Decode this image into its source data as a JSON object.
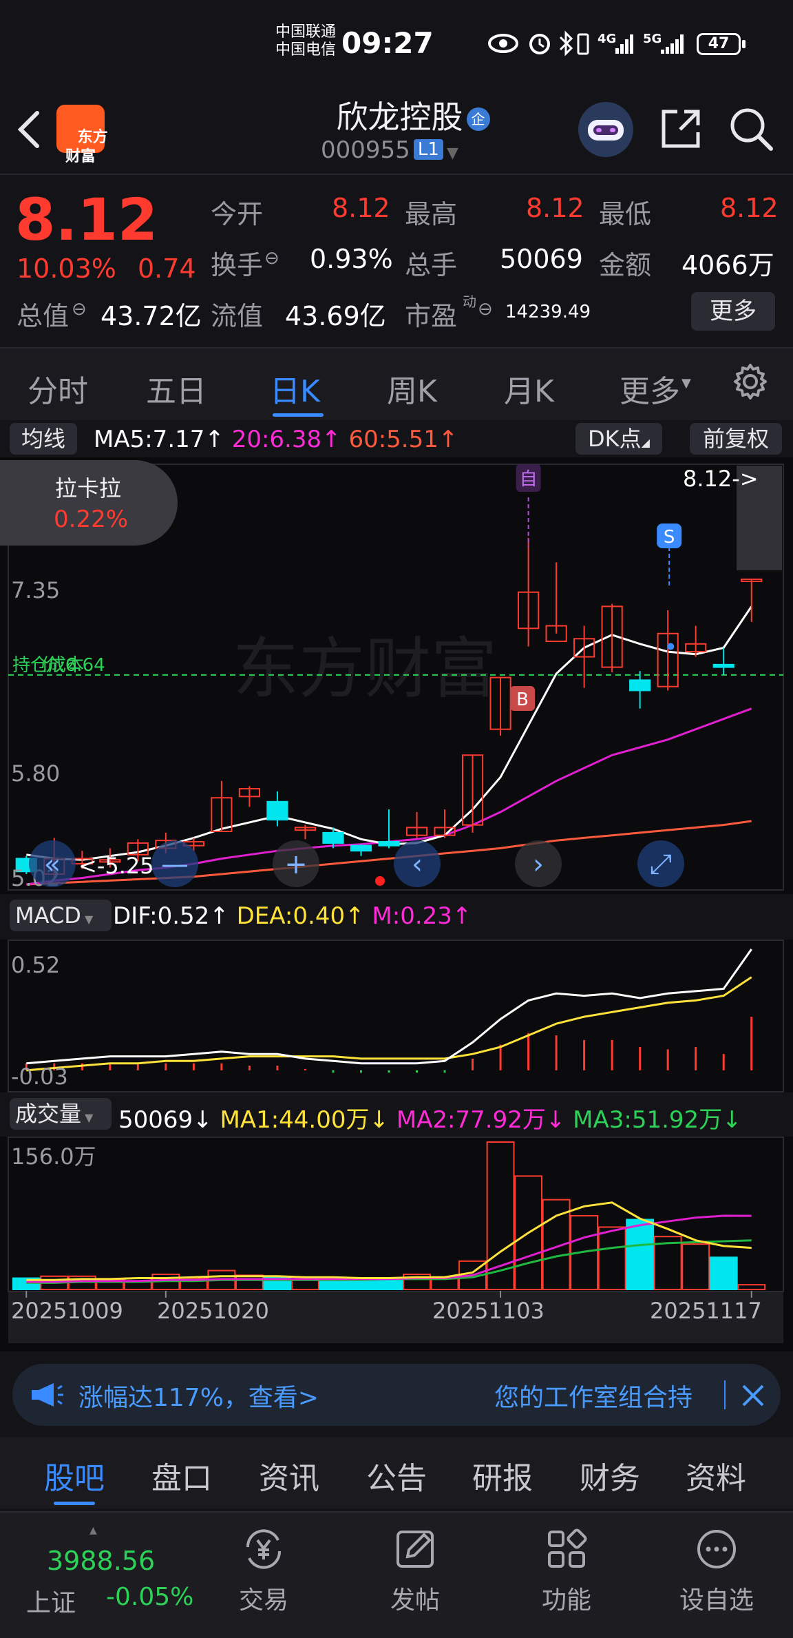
{
  "status_bar": {
    "carrier1": "中国联通",
    "carrier2": "中国电信",
    "time": "09:27",
    "signal1": "4G",
    "signal2": "5G",
    "battery": "47"
  },
  "header": {
    "app_logo": "东方\n财富",
    "stock_name": "欣龙控股",
    "stock_badge": "企",
    "stock_code": "000955",
    "level_badge": "L1"
  },
  "quote": {
    "price": "8.12",
    "change_pct": "10.03%",
    "change_abs": "0.74",
    "open_label": "今开",
    "open": "8.12",
    "high_label": "最高",
    "high": "8.12",
    "low_label": "最低",
    "low": "8.12",
    "turnover_label": "换手",
    "turnover": "0.93%",
    "volume_label": "总手",
    "volume": "50069",
    "amount_label": "金额",
    "amount": "4066万",
    "mktcap_label": "总值",
    "mktcap": "43.72亿",
    "float_label": "流值",
    "float": "43.69亿",
    "pe_label": "市盈",
    "pe_sup": "动",
    "pe": "14239.49",
    "more_label": "更多"
  },
  "period_tabs": {
    "items": [
      "分时",
      "五日",
      "日K",
      "周K",
      "月K",
      "更多"
    ],
    "active": "日K"
  },
  "kline": {
    "ma_selector": "均线",
    "ma5": "MA5:7.17",
    "ma20": "20:6.38",
    "ma60": "60:5.51",
    "dk_label": "DK点",
    "adjust_label": "前复权",
    "lakala_name": "拉卡拉",
    "lakala_pct": "0.22%",
    "price_marker": "8.12->",
    "y_top": "8.12",
    "y_mid1": "7.35",
    "y_mid2": "5.80",
    "y_bottom": "5.02",
    "cost_label": "持仓成本",
    "cost_price": "价:6.64",
    "low_marker": "<-5.25",
    "watermark": "东方财富",
    "badge_zi": "自",
    "badge_b": "B",
    "badge_s": "S"
  },
  "macd": {
    "selector": "MACD",
    "dif": "DIF:0.52",
    "dea": "DEA:0.40",
    "m": "M:0.23",
    "y_top": "0.52",
    "y_bottom": "-0.03"
  },
  "volume": {
    "selector": "成交量",
    "vol": "50069",
    "ma1": "MA1:44.00万",
    "ma2": "MA2:77.92万",
    "ma3": "MA3:51.92万",
    "y_top": "156.0万",
    "dates": [
      "20251009",
      "20251020",
      "20251103",
      "20251117"
    ]
  },
  "ticker": {
    "text1": "涨幅达117%，查看>",
    "text2": "您的工作室组合持"
  },
  "sub_tabs": {
    "items": [
      "股吧",
      "盘口",
      "资讯",
      "公告",
      "研报",
      "财务",
      "资料"
    ],
    "active": "股吧"
  },
  "bottom_nav": {
    "index_value": "3988.56",
    "index_name": "上证",
    "index_change": "-0.05%",
    "trade": "交易",
    "post": "发帖",
    "func": "功能",
    "watchlist": "设自选"
  },
  "colors": {
    "up": "#ff3b30",
    "down": "#00e5ee",
    "ma5": "#ffffff",
    "ma20": "#e020d0",
    "ma60": "#ff5a3c",
    "accent": "#3a8bff"
  },
  "chart_data": [
    {
      "type": "candlestick",
      "title": "日K",
      "ylim": [
        5.02,
        8.12
      ],
      "candles": [
        {
          "o": 5.22,
          "c": 5.12,
          "h": 5.24,
          "l": 5.1
        },
        {
          "o": 5.1,
          "c": 5.22,
          "h": 5.38,
          "l": 5.06
        },
        {
          "o": 5.18,
          "c": 5.22,
          "h": 5.28,
          "l": 5.14
        },
        {
          "o": 5.2,
          "c": 5.21,
          "h": 5.3,
          "l": 5.15
        },
        {
          "o": 5.25,
          "c": 5.34,
          "h": 5.37,
          "l": 5.2
        },
        {
          "o": 5.3,
          "c": 5.36,
          "h": 5.42,
          "l": 5.26
        },
        {
          "o": 5.32,
          "c": 5.35,
          "h": 5.38,
          "l": 5.28
        },
        {
          "o": 5.43,
          "c": 5.69,
          "h": 5.82,
          "l": 5.43
        },
        {
          "o": 5.7,
          "c": 5.76,
          "h": 5.78,
          "l": 5.62
        },
        {
          "o": 5.66,
          "c": 5.52,
          "h": 5.74,
          "l": 5.47
        },
        {
          "o": 5.44,
          "c": 5.46,
          "h": 5.48,
          "l": 5.37
        },
        {
          "o": 5.42,
          "c": 5.34,
          "h": 5.46,
          "l": 5.3
        },
        {
          "o": 5.32,
          "c": 5.28,
          "h": 5.33,
          "l": 5.24
        },
        {
          "o": 5.35,
          "c": 5.32,
          "h": 5.6,
          "l": 5.3
        },
        {
          "o": 5.4,
          "c": 5.46,
          "h": 5.58,
          "l": 5.38
        },
        {
          "o": 5.4,
          "c": 5.46,
          "h": 5.6,
          "l": 5.38
        },
        {
          "o": 5.48,
          "c": 6.02,
          "h": 6.02,
          "l": 5.42
        },
        {
          "o": 6.22,
          "c": 6.62,
          "h": 6.62,
          "l": 6.17
        },
        {
          "o": 7.0,
          "c": 7.28,
          "h": 7.7,
          "l": 6.86
        },
        {
          "o": 6.9,
          "c": 7.02,
          "h": 7.51,
          "l": 6.96
        },
        {
          "o": 6.78,
          "c": 6.92,
          "h": 7.02,
          "l": 6.54
        },
        {
          "o": 6.7,
          "c": 7.17,
          "h": 7.19,
          "l": 6.66
        },
        {
          "o": 6.6,
          "c": 6.52,
          "h": 6.67,
          "l": 6.38
        },
        {
          "o": 6.55,
          "c": 6.96,
          "h": 7.14,
          "l": 6.52
        },
        {
          "o": 6.82,
          "c": 6.88,
          "h": 7.02,
          "l": 6.78
        },
        {
          "o": 6.72,
          "c": 6.7,
          "h": 6.85,
          "l": 6.64
        },
        {
          "o": 7.38,
          "c": 7.38,
          "h": 7.38,
          "l": 7.05
        }
      ],
      "ma5": [
        5.25,
        5.22,
        5.21,
        5.24,
        5.27,
        5.32,
        5.38,
        5.45,
        5.5,
        5.55,
        5.5,
        5.45,
        5.37,
        5.33,
        5.34,
        5.4,
        5.6,
        5.85,
        6.25,
        6.65,
        6.85,
        6.95,
        6.88,
        6.82,
        6.8,
        6.85,
        7.17
      ],
      "ma20": [
        5.02,
        5.05,
        5.07,
        5.1,
        5.13,
        5.15,
        5.18,
        5.22,
        5.25,
        5.28,
        5.3,
        5.32,
        5.33,
        5.35,
        5.37,
        5.4,
        5.48,
        5.58,
        5.7,
        5.82,
        5.92,
        6.02,
        6.08,
        6.14,
        6.22,
        6.3,
        6.38
      ],
      "ma60": [
        5.02,
        5.03,
        5.04,
        5.05,
        5.06,
        5.07,
        5.08,
        5.1,
        5.12,
        5.14,
        5.16,
        5.18,
        5.2,
        5.22,
        5.24,
        5.26,
        5.28,
        5.3,
        5.33,
        5.36,
        5.38,
        5.4,
        5.42,
        5.44,
        5.46,
        5.48,
        5.51
      ]
    },
    {
      "type": "line",
      "title": "MACD",
      "ylim": [
        -0.03,
        0.52
      ],
      "dif": [
        0.03,
        0.04,
        0.05,
        0.06,
        0.06,
        0.06,
        0.07,
        0.08,
        0.07,
        0.07,
        0.05,
        0.04,
        0.03,
        0.03,
        0.03,
        0.04,
        0.12,
        0.22,
        0.3,
        0.33,
        0.32,
        0.33,
        0.31,
        0.33,
        0.34,
        0.35,
        0.52
      ],
      "dea": [
        0.0,
        0.01,
        0.02,
        0.03,
        0.03,
        0.04,
        0.04,
        0.05,
        0.06,
        0.06,
        0.06,
        0.06,
        0.05,
        0.05,
        0.05,
        0.05,
        0.07,
        0.1,
        0.15,
        0.2,
        0.23,
        0.25,
        0.27,
        0.29,
        0.3,
        0.32,
        0.4
      ],
      "m": [
        0.03,
        0.03,
        0.03,
        0.03,
        0.03,
        0.03,
        0.03,
        0.03,
        0.02,
        0.02,
        0.0,
        -0.01,
        -0.01,
        -0.01,
        -0.01,
        -0.01,
        0.05,
        0.11,
        0.16,
        0.15,
        0.13,
        0.13,
        0.1,
        0.09,
        0.1,
        0.07,
        0.23
      ]
    },
    {
      "type": "bar",
      "title": "成交量",
      "ylim": [
        0,
        156.0
      ],
      "unit": "万",
      "values": [
        12,
        14,
        14,
        10,
        12,
        16,
        12,
        20,
        15,
        13,
        11,
        11,
        10,
        12,
        16,
        13,
        30,
        156,
        120,
        95,
        78,
        66,
        74,
        56,
        48,
        34,
        5
      ],
      "ma1": [
        10,
        10,
        11,
        11,
        12,
        12,
        13,
        14,
        14,
        14,
        13,
        13,
        12,
        12,
        13,
        13,
        18,
        40,
        60,
        78,
        88,
        92,
        75,
        64,
        52,
        46,
        44
      ],
      "ma2": [
        8,
        8,
        9,
        9,
        9,
        10,
        10,
        11,
        11,
        11,
        11,
        11,
        11,
        11,
        12,
        12,
        15,
        25,
        35,
        45,
        55,
        62,
        68,
        72,
        76,
        78,
        77.92
      ],
      "ma3": [
        7,
        7,
        8,
        8,
        8,
        9,
        9,
        10,
        10,
        10,
        10,
        10,
        10,
        11,
        11,
        11,
        13,
        20,
        28,
        35,
        40,
        44,
        47,
        49,
        50,
        51,
        51.92
      ]
    }
  ]
}
